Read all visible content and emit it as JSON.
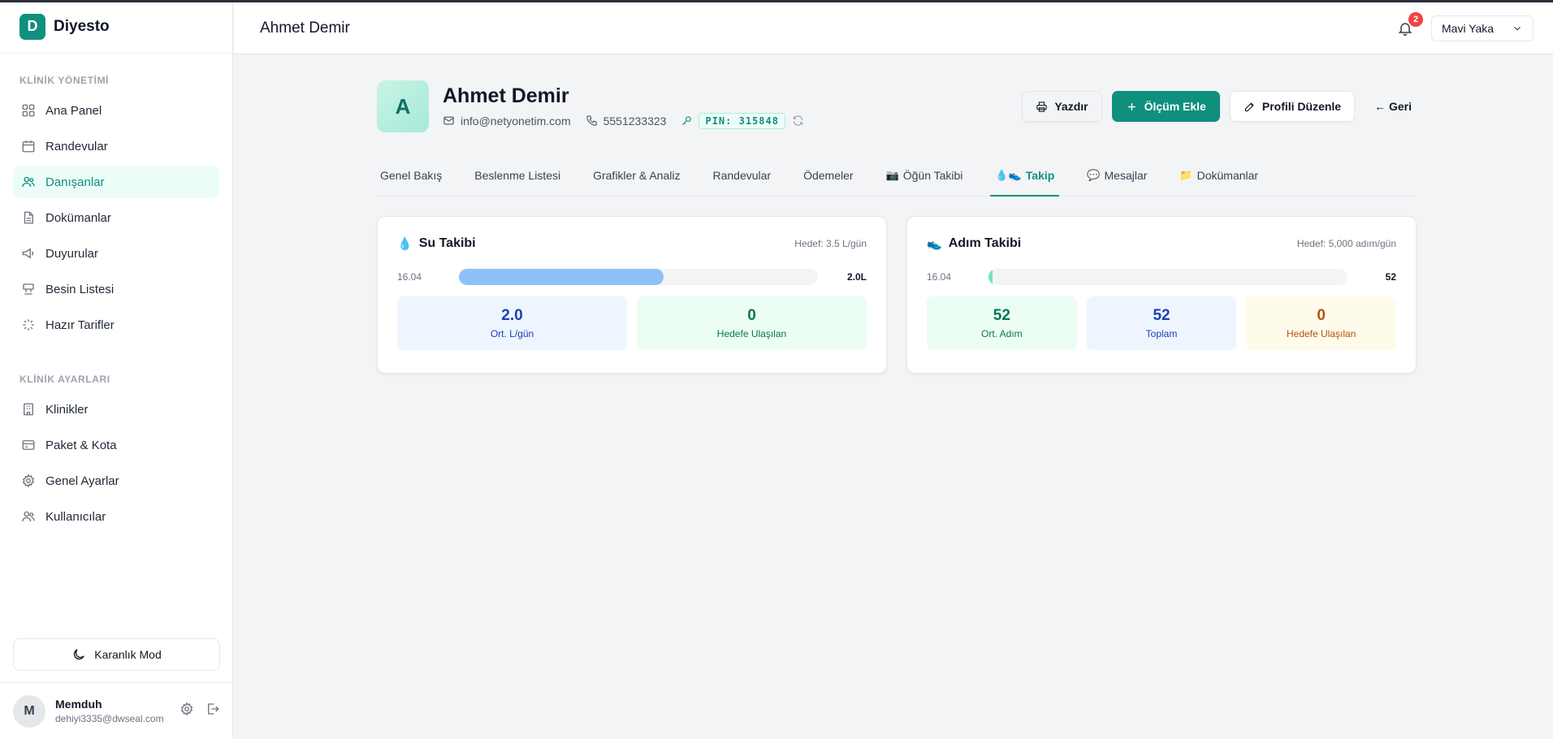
{
  "app": {
    "name": "Diyesto",
    "logo_letter": "D"
  },
  "sidebar": {
    "section_clinic": "KLİNİK YÖNETİMİ",
    "items": [
      {
        "label": "Ana Panel",
        "icon": "grid-icon"
      },
      {
        "label": "Randevular",
        "icon": "calendar-icon"
      },
      {
        "label": "Danışanlar",
        "icon": "users-icon",
        "active": true
      },
      {
        "label": "Dokümanlar",
        "icon": "document-icon"
      },
      {
        "label": "Duyurular",
        "icon": "megaphone-icon"
      },
      {
        "label": "Besin Listesi",
        "icon": "food-icon"
      },
      {
        "label": "Hazır Tarifler",
        "icon": "sparkle-icon"
      }
    ],
    "section_settings": "KLİNİK AYARLARI",
    "settings_items": [
      {
        "label": "Klinikler",
        "icon": "building-icon"
      },
      {
        "label": "Paket & Kota",
        "icon": "card-icon"
      },
      {
        "label": "Genel Ayarlar",
        "icon": "gear-icon"
      },
      {
        "label": "Kullanıcılar",
        "icon": "users-icon"
      }
    ],
    "dark_mode_label": "Karanlık Mod",
    "user": {
      "initial": "M",
      "name": "Memduh",
      "email": "dehiyi3335@dwseal.com"
    }
  },
  "header": {
    "title": "Ahmet Demir",
    "notification_count": "2",
    "clinic_select": "Mavi Yaka"
  },
  "profile": {
    "initial": "A",
    "name": "Ahmet Demir",
    "email": "info@netyonetim.com",
    "phone": "5551233323",
    "pin": "PIN: 315848",
    "actions": {
      "print": "Yazdır",
      "add_measurement": "Ölçüm Ekle",
      "edit_profile": "Profili Düzenle",
      "back": "← Geri"
    }
  },
  "tabs": [
    {
      "label": "Genel Bakış",
      "emoji": ""
    },
    {
      "label": "Beslenme Listesi",
      "emoji": ""
    },
    {
      "label": "Grafikler & Analiz",
      "emoji": ""
    },
    {
      "label": "Randevular",
      "emoji": ""
    },
    {
      "label": "Ödemeler",
      "emoji": ""
    },
    {
      "label": "Öğün Takibi",
      "emoji": "📷"
    },
    {
      "label": "Takip",
      "emoji": "💧👟",
      "active": true
    },
    {
      "label": "Mesajlar",
      "emoji": "💬"
    },
    {
      "label": "Dokümanlar",
      "emoji": "📁"
    }
  ],
  "water": {
    "emoji": "💧",
    "title": "Su Takibi",
    "goal": "Hedef: 3.5 L/gün",
    "date": "16.04",
    "value_label": "2.0L",
    "progress": 0.571,
    "bar_color": "#8ec1f5",
    "stats": [
      {
        "value": "2.0",
        "label": "Ort. L/gün"
      },
      {
        "value": "0",
        "label": "Hedefe Ulaşılan"
      }
    ]
  },
  "steps": {
    "emoji": "👟",
    "title": "Adım Takibi",
    "goal": "Hedef: 5,000 adım/gün",
    "date": "16.04",
    "value_label": "52",
    "progress": 0.0104,
    "bar_color": "#6ee7b7",
    "stats": [
      {
        "value": "52",
        "label": "Ort. Adım"
      },
      {
        "value": "52",
        "label": "Toplam"
      },
      {
        "value": "0",
        "label": "Hedefe Ulaşılan"
      }
    ]
  }
}
